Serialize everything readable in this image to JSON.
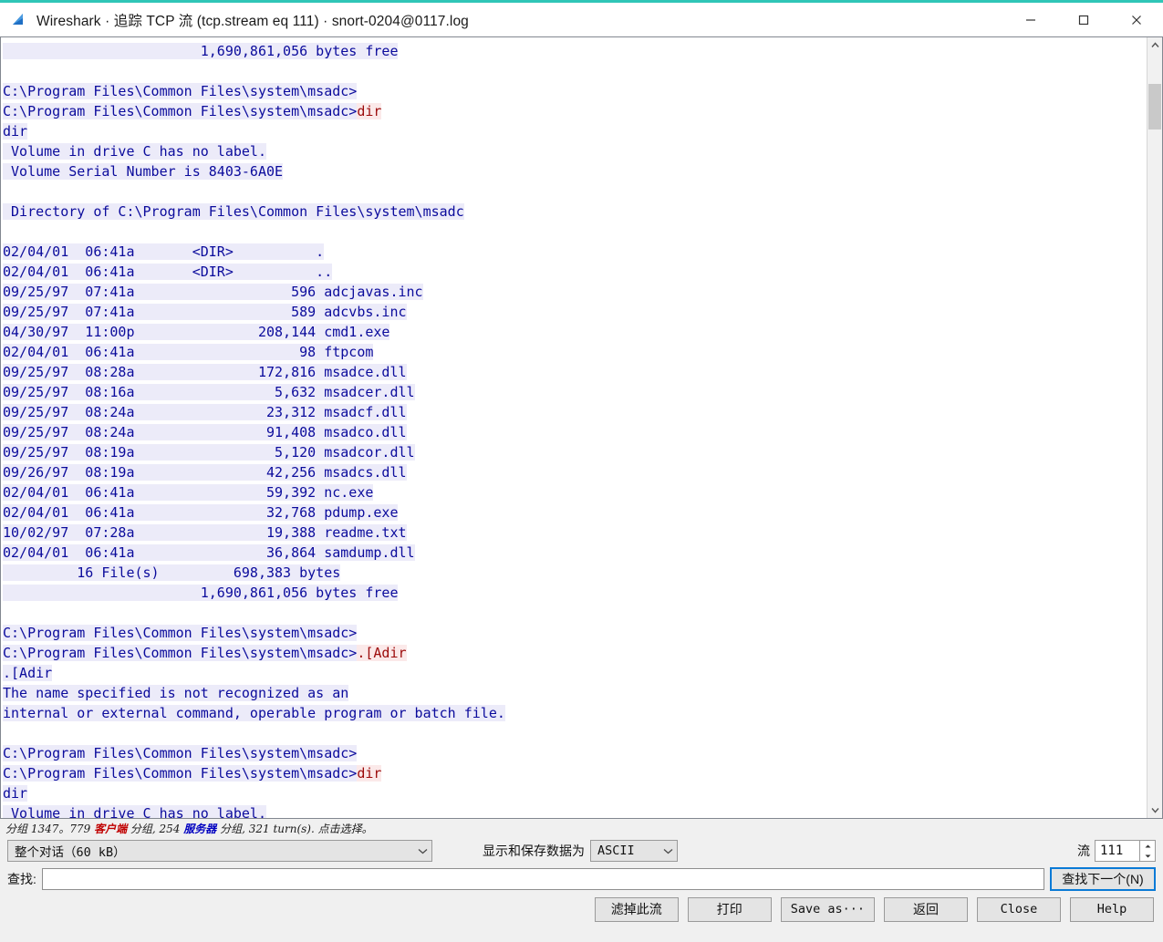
{
  "window": {
    "title": "Wireshark · 追踪 TCP 流 (tcp.stream eq 111) · snort-0204@0117.log",
    "icon": "wireshark-fin-icon",
    "accent_color": "#2fc6b7",
    "minimize_label": "—",
    "maximize_label": "□",
    "close_label": "✕"
  },
  "colors": {
    "server_text": "#0b0b9c",
    "server_bg": "#ecebf9",
    "client_text": "#9c0b0b",
    "client_bg": "#fbe9e9",
    "focus_border": "#0a7ad6"
  },
  "stream": {
    "lines": [
      {
        "kind": "srv",
        "text": "                        1,690,861,056 bytes free"
      },
      {
        "kind": "blank",
        "text": ""
      },
      {
        "kind": "srv",
        "text": "C:\\Program Files\\Common Files\\system\\msadc>"
      },
      {
        "kind": "mixed",
        "parts": [
          {
            "kind": "srv",
            "text": "C:\\Program Files\\Common Files\\system\\msadc>"
          },
          {
            "kind": "cli",
            "text": "dir"
          }
        ]
      },
      {
        "kind": "srv",
        "text": "dir"
      },
      {
        "kind": "srv",
        "text": " Volume in drive C has no label."
      },
      {
        "kind": "srv",
        "text": " Volume Serial Number is 8403-6A0E"
      },
      {
        "kind": "blank",
        "text": ""
      },
      {
        "kind": "srv",
        "text": " Directory of C:\\Program Files\\Common Files\\system\\msadc"
      },
      {
        "kind": "blank",
        "text": ""
      },
      {
        "kind": "srv",
        "text": "02/04/01  06:41a       <DIR>          ."
      },
      {
        "kind": "srv",
        "text": "02/04/01  06:41a       <DIR>          .."
      },
      {
        "kind": "srv",
        "text": "09/25/97  07:41a                   596 adcjavas.inc"
      },
      {
        "kind": "srv",
        "text": "09/25/97  07:41a                   589 adcvbs.inc"
      },
      {
        "kind": "srv",
        "text": "04/30/97  11:00p               208,144 cmd1.exe"
      },
      {
        "kind": "srv",
        "text": "02/04/01  06:41a                    98 ftpcom"
      },
      {
        "kind": "srv",
        "text": "09/25/97  08:28a               172,816 msadce.dll"
      },
      {
        "kind": "srv",
        "text": "09/25/97  08:16a                 5,632 msadcer.dll"
      },
      {
        "kind": "srv",
        "text": "09/25/97  08:24a                23,312 msadcf.dll"
      },
      {
        "kind": "srv",
        "text": "09/25/97  08:24a                91,408 msadco.dll"
      },
      {
        "kind": "srv",
        "text": "09/25/97  08:19a                 5,120 msadcor.dll"
      },
      {
        "kind": "srv",
        "text": "09/26/97  08:19a                42,256 msadcs.dll"
      },
      {
        "kind": "srv",
        "text": "02/04/01  06:41a                59,392 nc.exe"
      },
      {
        "kind": "srv",
        "text": "02/04/01  06:41a                32,768 pdump.exe"
      },
      {
        "kind": "srv",
        "text": "10/02/97  07:28a                19,388 readme.txt"
      },
      {
        "kind": "srv",
        "text": "02/04/01  06:41a                36,864 samdump.dll"
      },
      {
        "kind": "srv",
        "text": "         16 File(s)         698,383 bytes"
      },
      {
        "kind": "srv",
        "text": "                        1,690,861,056 bytes free"
      },
      {
        "kind": "blank",
        "text": ""
      },
      {
        "kind": "srv",
        "text": "C:\\Program Files\\Common Files\\system\\msadc>"
      },
      {
        "kind": "mixed",
        "parts": [
          {
            "kind": "srv",
            "text": "C:\\Program Files\\Common Files\\system\\msadc>"
          },
          {
            "kind": "cli",
            "text": ".[Adir"
          }
        ]
      },
      {
        "kind": "srv",
        "text": ".[Adir"
      },
      {
        "kind": "srv",
        "text": "The name specified is not recognized as an"
      },
      {
        "kind": "srv",
        "text": "internal or external command, operable program or batch file."
      },
      {
        "kind": "blank",
        "text": ""
      },
      {
        "kind": "srv",
        "text": "C:\\Program Files\\Common Files\\system\\msadc>"
      },
      {
        "kind": "mixed",
        "parts": [
          {
            "kind": "srv",
            "text": "C:\\Program Files\\Common Files\\system\\msadc>"
          },
          {
            "kind": "cli",
            "text": "dir"
          }
        ]
      },
      {
        "kind": "srv",
        "text": "dir"
      },
      {
        "kind": "srv",
        "text": " Volume in drive C has no label."
      }
    ]
  },
  "status": {
    "prefix": "分组 1347。779 ",
    "client_word": "客户端",
    "middle": " 分组, 254 ",
    "server_word": "服务器",
    "suffix": " 分组, 321 turn(s). 点击选择。"
  },
  "options": {
    "conversation_value": "整个对话（60 kB）",
    "show_save_label": "显示和保存数据为",
    "encoding_value": "ASCII",
    "stream_label": "流",
    "stream_value": "111",
    "chevron": "⌄",
    "spin_up": "▲",
    "spin_down": "▼"
  },
  "find": {
    "label": "查找:",
    "value": "",
    "placeholder": "",
    "find_next_label": "查找下一个(N)"
  },
  "buttons": {
    "filter_out": "滤掉此流",
    "print": "打印",
    "save_as": "Save as···",
    "back": "返回",
    "close": "Close",
    "help": "Help"
  }
}
